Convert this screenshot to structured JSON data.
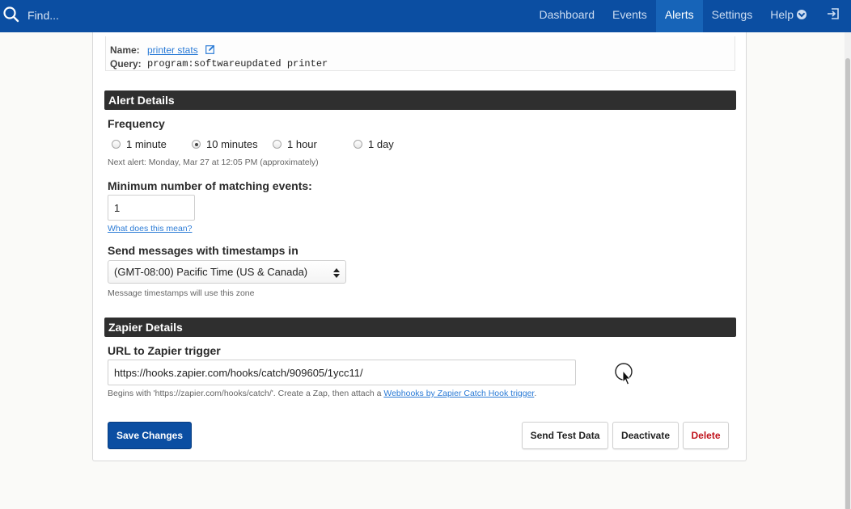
{
  "topbar": {
    "search_placeholder": "Find...",
    "nav": [
      "Dashboard",
      "Events",
      "Alerts",
      "Settings",
      "Help"
    ],
    "active_nav": "Alerts"
  },
  "search": {
    "name_label": "Name:",
    "name_value": "printer stats",
    "query_label": "Query:",
    "query_value": "program:softwareupdated printer"
  },
  "alert_details": {
    "title": "Alert Details",
    "frequency_label": "Frequency",
    "frequency_options": [
      "1 minute",
      "10 minutes",
      "1 hour",
      "1 day"
    ],
    "frequency_selected": "10 minutes",
    "next_alert": "Next alert: Monday, Mar 27 at 12:05 PM (approximately)",
    "min_events_label": "Minimum number of matching events:",
    "min_events_value": "1",
    "what_link": "What does this mean?",
    "timestamps_label": "Send messages with timestamps in",
    "timezone_value": "(GMT-08:00) Pacific Time (US & Canada)",
    "timezone_help": "Message timestamps will use this zone"
  },
  "zapier": {
    "title": "Zapier Details",
    "url_label": "URL to Zapier trigger",
    "url_value": "https://hooks.zapier.com/hooks/catch/909605/1ycc11/",
    "help_prefix": "Begins with 'https://zapier.com/hooks/catch/'. Create a Zap, then attach a ",
    "help_link": "Webhooks by Zapier Catch Hook trigger",
    "help_suffix": "."
  },
  "buttons": {
    "save": "Save Changes",
    "send_test": "Send Test Data",
    "deactivate": "Deactivate",
    "delete": "Delete"
  },
  "colors": {
    "topbar": "#0b4ea2",
    "active_nav": "#1764b8",
    "primary_button": "#0b4ea2",
    "section_header": "#2f2f2f",
    "link": "#2b7bd6",
    "danger": "#c0121b"
  },
  "icons": [
    "search-icon",
    "edit-icon",
    "help-circle-icon",
    "logout-icon",
    "select-arrows-icon",
    "mouse-cursor-icon"
  ]
}
